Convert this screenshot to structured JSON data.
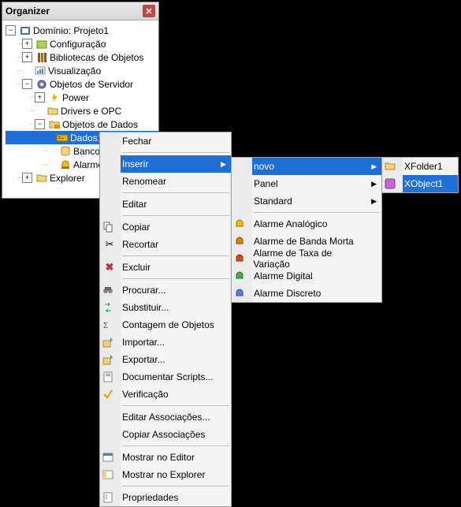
{
  "panelTitle": "Organizer",
  "tree": {
    "root": "Domínio: Projeto1",
    "n1": "Configuração",
    "n2": "Bibliotecas de Objetos",
    "n3": "Visualização",
    "n4": "Objetos de Servidor",
    "n5": "Power",
    "n6": "Drivers e OPC",
    "n7": "Objetos de Dados",
    "n8": "Dados1",
    "n9": "Banco de Dados",
    "n10": "Alarmes",
    "n11": "Explorer"
  },
  "menu1": {
    "fechar": "Fechar",
    "inserir": "Inserir",
    "renomear": "Renomear",
    "editar": "Editar",
    "copiar": "Copiar",
    "recortar": "Recortar",
    "excluir": "Excluir",
    "procurar": "Procurar...",
    "substituir": "Substituir...",
    "contagem": "Contagem de Objetos",
    "importar": "Importar...",
    "exportar": "Exportar...",
    "docscripts": "Documentar Scripts...",
    "verificacao": "Verificação",
    "editassoc": "Editar Associações...",
    "copiarassoc": "Copiar Associações",
    "mostrareditor": "Mostrar no Editor",
    "mostrarexplorer": "Mostrar no Explorer",
    "propriedades": "Propriedades"
  },
  "menu2": {
    "novo": "novo",
    "panel": "Panel",
    "standard": "Standard",
    "alarmeanalogico": "Alarme Analógico",
    "alarmebanda": "Alarme de Banda Morta",
    "alarmetaxa": "Alarme de Taxa de Variação",
    "alarmedigital": "Alarme Digital",
    "alarmediscreto": "Alarme Discreto"
  },
  "menu3": {
    "xfolder1": "XFolder1",
    "xobject1": "XObject1"
  }
}
